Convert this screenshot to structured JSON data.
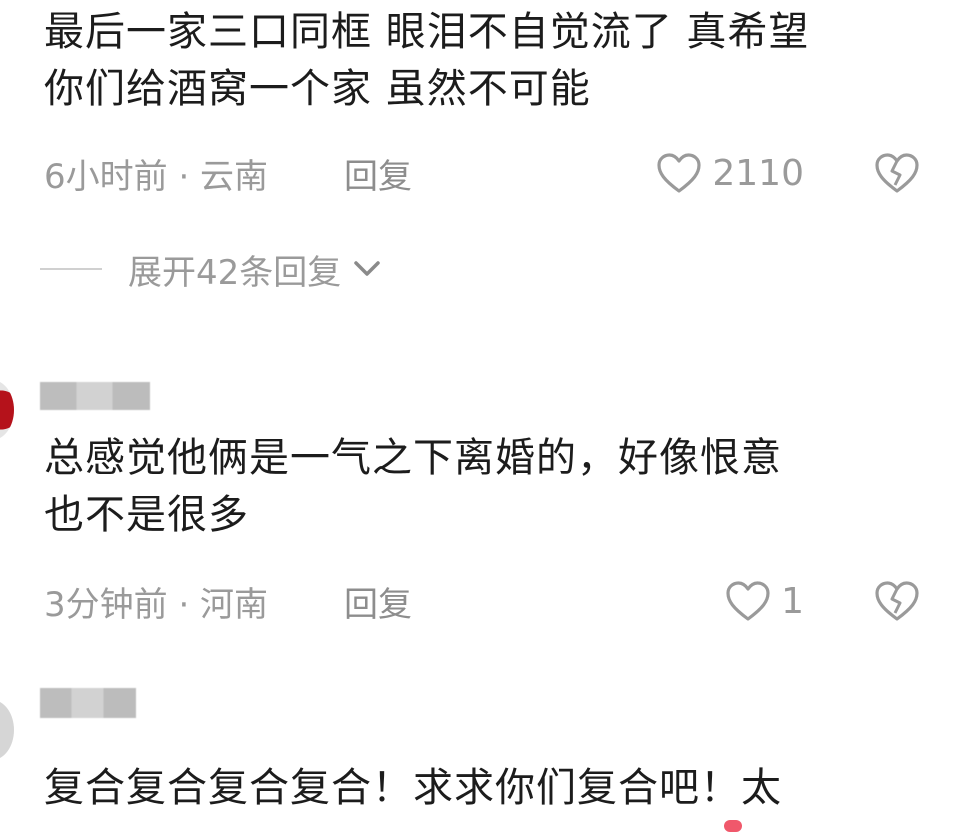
{
  "comments": [
    {
      "text_lines": [
        "最后一家三口同框 眼泪不自觉流了 真希望",
        "你们给酒窝一个家 虽然不可能"
      ],
      "time_location": "6小时前 · 云南",
      "reply_label": "回复",
      "like_count": "2110"
    },
    {
      "text_lines": [
        "总感觉他俩是一气之下离婚的，好像恨意",
        "也不是很多"
      ],
      "time_location": "3分钟前 · 河南",
      "reply_label": "回复",
      "like_count": "1"
    },
    {
      "text_lines": [
        "复合复合复合复合！求求你们复合吧！太"
      ]
    }
  ],
  "expand_replies_label": "展开42条回复",
  "icons": {
    "like": "heart-outline-icon",
    "dislike": "broken-heart-icon",
    "expand": "chevron-down-icon"
  },
  "colors": {
    "text": "#1c1c1c",
    "meta": "#9a9a9a",
    "accent_heart": "#f0586b"
  }
}
